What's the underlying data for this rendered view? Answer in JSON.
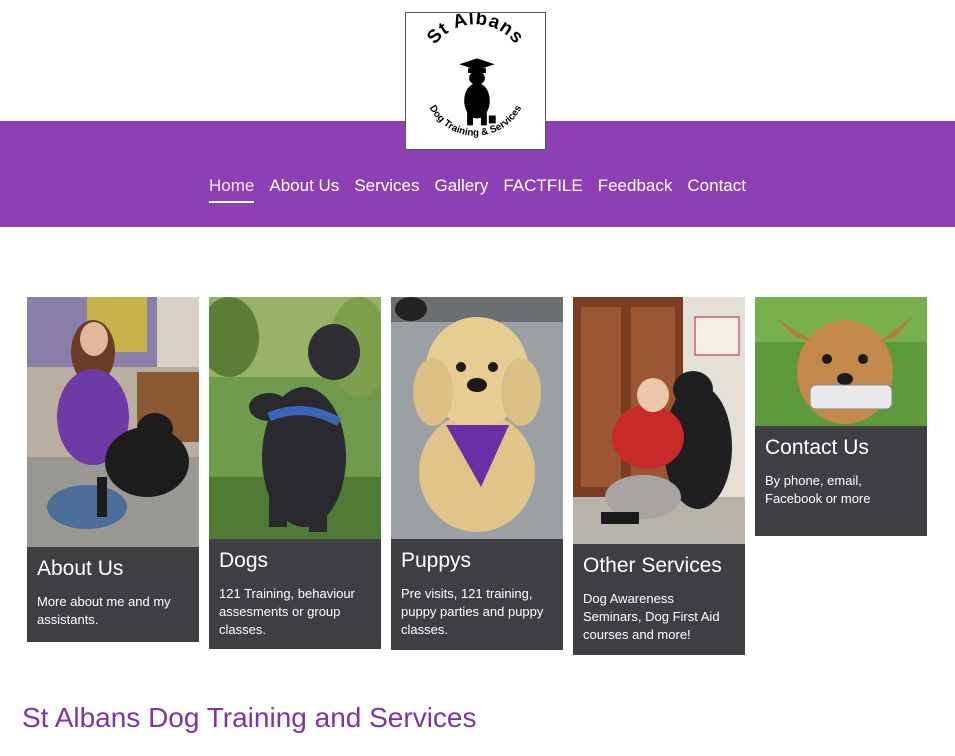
{
  "logo": {
    "top_text": "St Albans",
    "bottom_text": "Dog Training & Services"
  },
  "nav": {
    "items": [
      "Home",
      "About Us",
      "Services",
      "Gallery",
      "FACTFILE",
      "Feedback",
      "Contact"
    ],
    "active": "Home"
  },
  "cards": [
    {
      "title": "About Us",
      "desc": "More about me and my assistants.",
      "photo": "woman-with-dog-photo"
    },
    {
      "title": "Dogs",
      "desc": "121 Training, behaviour assesments or group classes.",
      "photo": "sitting-staffie-photo"
    },
    {
      "title": "Puppys",
      "desc": "Pre visits, 121 training, puppy parties and puppy classes.",
      "photo": "labradoodle-puppy-photo"
    },
    {
      "title": "Other Services",
      "desc": "Dog Awareness Seminars, Dog First Aid courses and more!",
      "photo": "boy-with-dog-photo"
    },
    {
      "title": "Contact Us",
      "desc": "By phone, email, Facebook or more",
      "photo": "terrier-with-phone-photo"
    }
  ],
  "main_heading": "St Albans Dog Training and Services",
  "colors": {
    "brand_purple": "#8d3fb4",
    "heading_purple": "#7b35a8",
    "card_panel": "#3f3e42"
  }
}
